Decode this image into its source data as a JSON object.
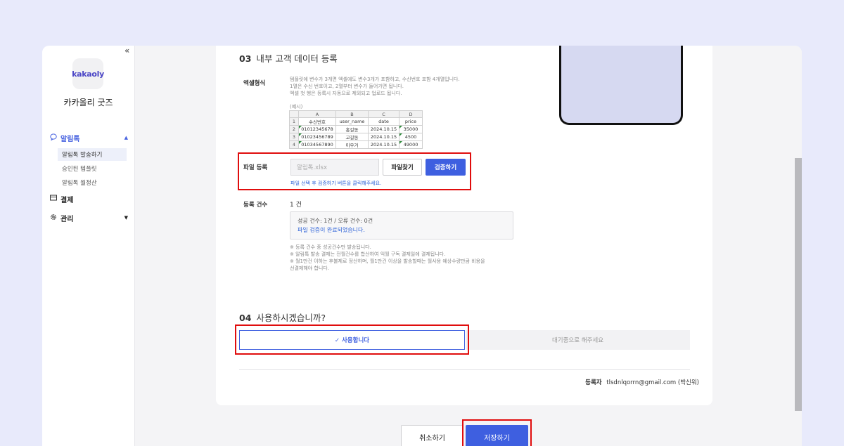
{
  "sidebar": {
    "collapse": "«",
    "logo_text": "kakaoly",
    "brand_name": "카카올리 굿즈",
    "groups": [
      {
        "label": "알림톡",
        "icon": "chat-bubble-icon",
        "caret": "▲"
      },
      {
        "label": "결제",
        "icon": "card-icon"
      },
      {
        "label": "관리",
        "icon": "gear-icon",
        "caret": "▼"
      }
    ],
    "sub_items": [
      "알림톡 발송하기",
      "승인된 템플릿",
      "알림톡 월정산"
    ]
  },
  "section3": {
    "number": "03",
    "title": "내부 고객 데이터 등록",
    "excel_format_label": "엑셀형식",
    "excel_notes": [
      "템플릿에 변수가 3개면 엑셀에도 변수3개가 포함하고, 수신번호 포함 4개열입니다.",
      "1열은 수신 번호이고, 2열부터 변수가 들어가면 됩니다.",
      "엑셀 첫 행은 등록시 자동으로 제외되고 업로드 됩니다."
    ],
    "example_label": "(예시)",
    "excel_example": {
      "col_headers": [
        "A",
        "B",
        "C",
        "D"
      ],
      "rows": [
        [
          "1",
          "수신번호",
          "user_name",
          "date",
          "price"
        ],
        [
          "2",
          "01012345678",
          "홍길동",
          "2024.10.15",
          "35000"
        ],
        [
          "3",
          "01023456789",
          "고길동",
          "2024.10.15",
          "4500"
        ],
        [
          "4",
          "01034567890",
          "이우거",
          "2024.10.15",
          "49000"
        ]
      ]
    },
    "file_label": "파일 등록",
    "file_placeholder": "알림톡.xlsx",
    "find_button": "파일찾기",
    "verify_button": "검증하기",
    "file_hint": "파일 선택 후 검증하기 버튼을 클릭해주세요.",
    "count_label": "등록 건수",
    "count_value": "1 건",
    "result_line1": "성공 건수: 1건 / 오류 건수: 0건",
    "result_line2": "파일 검증이 완료되었습니다.",
    "footnotes": [
      "※ 등록 건수 중 성공건수만 발송됩니다.",
      "※ 알림톡 발송 결제는 전월건수를 합산하여 익월 구독 결제일에 결제됩니다.",
      "※ 월1만건 이하는 후불제로 정산하며, 월1만건 이상을 발송할때는 월사용 예상수량만큼 비용을",
      "선결제해야 합니다."
    ]
  },
  "section4": {
    "number": "04",
    "title": "사용하시겠습니까?",
    "use_button": "✓ 사용합니다",
    "wait_button": "대기중으로 해주세요"
  },
  "registrant": {
    "label": "등록자",
    "value": "tlsdnlqorrn@gmail.com (박신워)"
  },
  "footer": {
    "cancel": "취소하기",
    "save": "저장하기"
  },
  "colors": {
    "accent": "#3e5fe0",
    "highlight_red": "#e00d0d",
    "page_bg": "#e8eafb",
    "phone_preview": "#d6d9f1"
  }
}
